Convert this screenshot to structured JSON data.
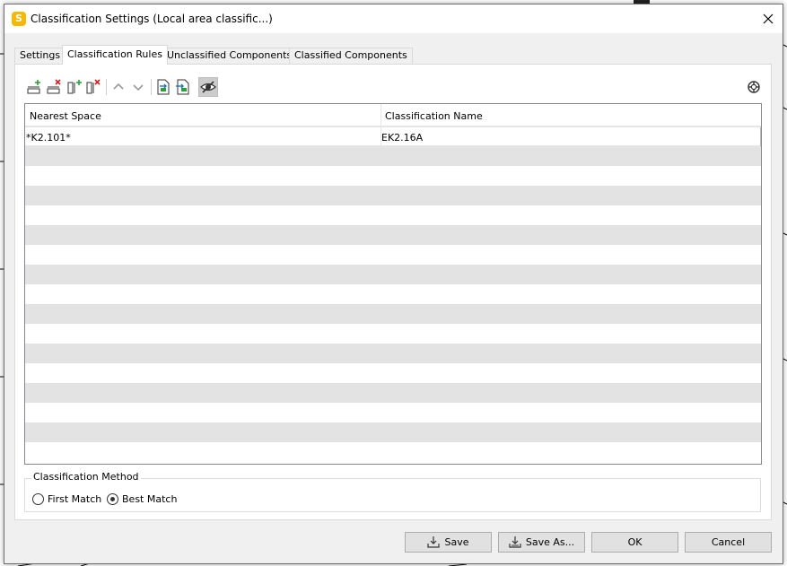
{
  "window": {
    "title": "Classification Settings (Local area classific...)",
    "app_icon_letter": "S"
  },
  "tabs": [
    {
      "label": "Settings",
      "active": false
    },
    {
      "label": "Classification Rules",
      "active": true
    },
    {
      "label": "Unclassified Components",
      "active": false
    },
    {
      "label": "Classified Components",
      "active": false
    }
  ],
  "toolbar": {
    "buttons": [
      "add-row-icon",
      "delete-row-icon",
      "add-column-icon",
      "delete-column-icon",
      "move-up-icon",
      "move-down-icon",
      "export-icon",
      "import-icon",
      "hide-eye-icon",
      "help-lifebuoy-icon"
    ]
  },
  "grid": {
    "columns": [
      "Nearest Space",
      "Classification Name"
    ],
    "rows": [
      {
        "nearest_space": "*K2.101*",
        "classification_name": "EK2.16A"
      }
    ]
  },
  "classification_method": {
    "label": "Classification Method",
    "options": [
      {
        "label": "First Match",
        "selected": false
      },
      {
        "label": "Best Match",
        "selected": true
      }
    ]
  },
  "buttons": {
    "save": "Save",
    "save_as": "Save As...",
    "ok": "OK",
    "cancel": "Cancel"
  },
  "colors": {
    "app_icon": "#f5b800",
    "alt_row": "#e3e3e3",
    "delete_red": "#d92020",
    "add_green": "#2e9e3a",
    "io_blue": "#1e73be"
  }
}
